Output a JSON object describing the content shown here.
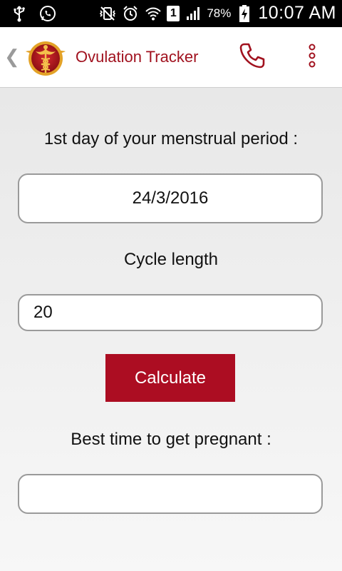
{
  "statusbar": {
    "battery_percent": "78%",
    "sim_slot": "1",
    "time": "10:07 AM",
    "icons": [
      "usb-icon",
      "whatsapp-icon",
      "vibrate-mute-icon",
      "alarm-icon",
      "wifi-icon",
      "sim-icon",
      "signal-icon",
      "battery-charging-icon"
    ]
  },
  "appbar": {
    "title": "Ovulation Tracker",
    "back_icon": "chevron-left-icon",
    "logo_icon": "caduceus-logo",
    "call_icon": "phone-icon",
    "menu_icon": "overflow-menu-icon",
    "accent_color": "#a1121f"
  },
  "form": {
    "period_label": "1st day of your menstrual period :",
    "period_value": "24/3/2016",
    "cycle_label": "Cycle length",
    "cycle_value": "20",
    "calculate_label": "Calculate",
    "result_label": "Best time to get pregnant :",
    "result_value": ""
  }
}
